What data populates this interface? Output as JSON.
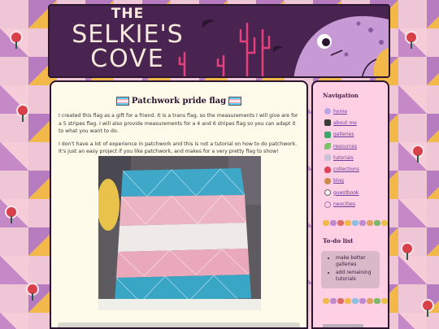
{
  "site": {
    "title_line1": "THE",
    "title_line2": "SELKIE'S",
    "title_line3": "COVE"
  },
  "post": {
    "title": "Patchwork pride flag",
    "paragraphs": [
      "I created this flag as a gift for a friend. It is a trans flag, so the measurements I will give are for a 5 stripes flag. I will also provide measurements for a 4 and 6 stripes flag so you can adapt it to what you want to do.",
      "I don't have a lot of experience in patchwork and this is not a tutorial on how to do patchwork. It's just an easy project if you like patchwork, and makes for a very pretty flag to show!"
    ]
  },
  "sidebar": {
    "nav_heading": "Navigation",
    "nav_items": [
      {
        "label": "home",
        "icon": "bubble-icon"
      },
      {
        "label": "about me",
        "icon": "camera-icon"
      },
      {
        "label": "galleries",
        "icon": "gallery-icon"
      },
      {
        "label": "resources",
        "icon": "leaf-icon"
      },
      {
        "label": "tutorials",
        "icon": "clip-icon"
      },
      {
        "label": "collections",
        "icon": "strawberry-icon"
      },
      {
        "label": "blog",
        "icon": "cookie-icon"
      },
      {
        "label": "guestbook",
        "icon": "skull-icon"
      },
      {
        "label": "neocities",
        "icon": "cloud-icon"
      }
    ],
    "todo_heading": "To-do list",
    "todo_items": [
      "make better galleries",
      "add remaining tutorials"
    ]
  },
  "colors": {
    "banner_bg": "#4a2450",
    "banner_pink": "#e6407c",
    "main_bg": "#fffbea",
    "sidebar_bg": "#ffcfe3",
    "link": "#6a3d9a"
  }
}
